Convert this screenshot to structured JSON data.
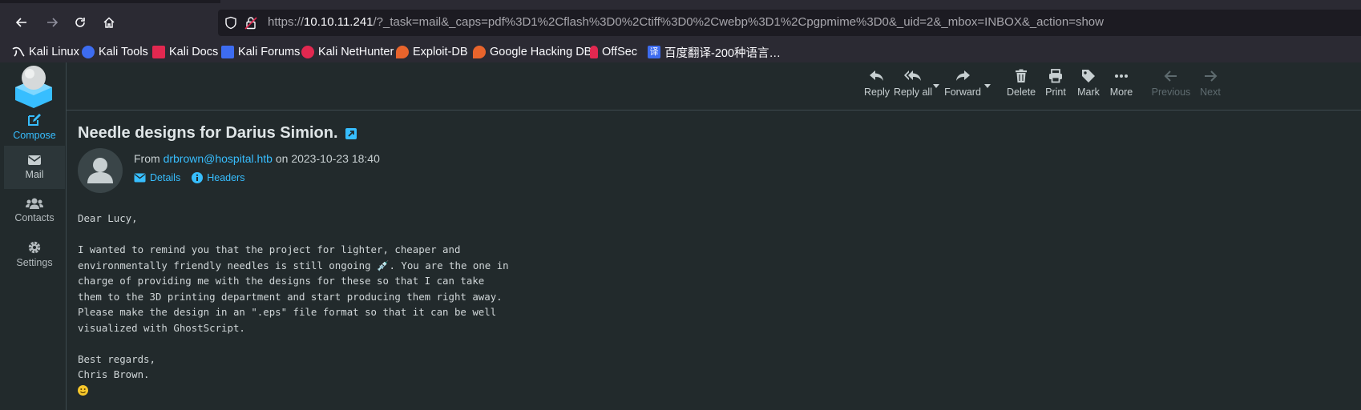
{
  "browser": {
    "url_prefix": "https://",
    "url_host": "10.10.11.241",
    "url_rest": "/?_task=mail&_caps=pdf%3D1%2Cflash%3D0%2Ctiff%3D0%2Cwebp%3D1%2Cpgpmime%3D0&_uid=2&_mbox=INBOX&_action=show"
  },
  "bookmarks": [
    {
      "label": "Kali Linux"
    },
    {
      "label": "Kali Tools"
    },
    {
      "label": "Kali Docs"
    },
    {
      "label": "Kali Forums"
    },
    {
      "label": "Kali NetHunter"
    },
    {
      "label": "Exploit-DB"
    },
    {
      "label": "Google Hacking DB"
    },
    {
      "label": "OffSec"
    },
    {
      "label": "百度翻译-200种语言…"
    }
  ],
  "sidebar": {
    "compose": "Compose",
    "mail": "Mail",
    "contacts": "Contacts",
    "settings": "Settings"
  },
  "toolbar": {
    "reply": "Reply",
    "reply_all": "Reply all",
    "forward": "Forward",
    "delete": "Delete",
    "print": "Print",
    "mark": "Mark",
    "more": "More",
    "previous": "Previous",
    "next": "Next"
  },
  "message": {
    "subject": "Needle designs for Darius Simion.",
    "from_label": "From",
    "from_email": "drbrown@hospital.htb",
    "date_prefix": "on",
    "date": "2023-10-23 18:40",
    "details": "Details",
    "headers": "Headers",
    "body_1": "Dear Lucy,\n\nI wanted to remind you that the project for lighter, cheaper and\nenvironmentally friendly needles is still ongoing ",
    "body_needle": "💉",
    "body_2": ". You are the one in\ncharge of providing me with the designs for these so that I can take\nthem to the 3D printing department and start producing them right away.\nPlease make the design in an \".eps\" file format so that it can be well\nvisualized with GhostScript.\n\nBest regards,\nChris Brown.\n"
  },
  "colors": {
    "accent": "#37beff",
    "background": "#222a2c",
    "browser_chrome": "#2b2a33"
  }
}
